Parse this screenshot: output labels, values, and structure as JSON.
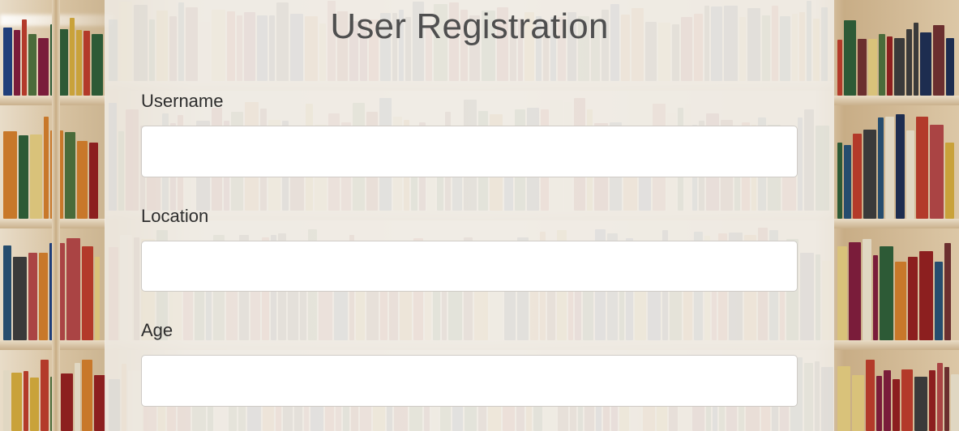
{
  "form": {
    "title": "User Registration",
    "fields": [
      {
        "label": "Username",
        "value": "",
        "placeholder": ""
      },
      {
        "label": "Location",
        "value": "",
        "placeholder": ""
      },
      {
        "label": "Age",
        "value": "",
        "placeholder": ""
      }
    ]
  }
}
